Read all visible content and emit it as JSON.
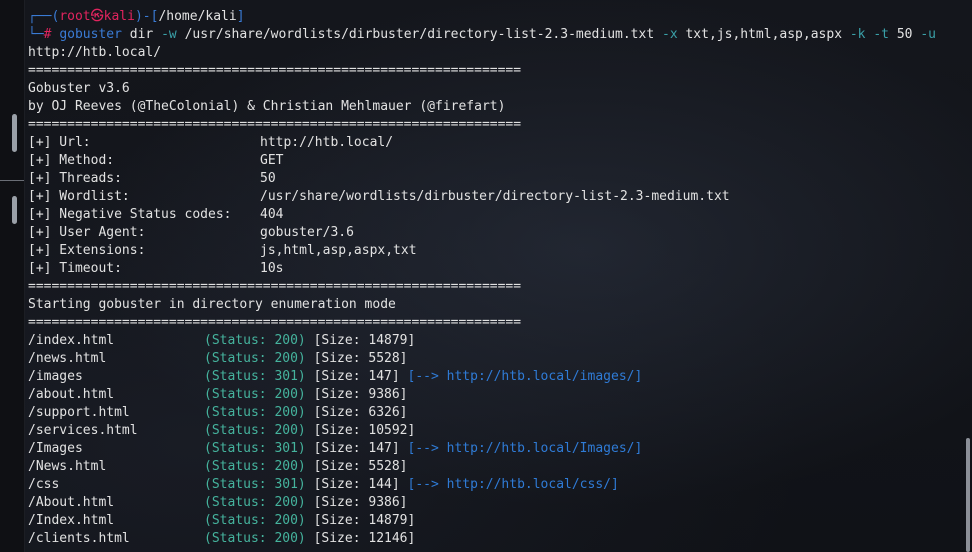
{
  "prompt": {
    "user": "root",
    "symbol": "㉿",
    "host": "kali",
    "path": "/home/kali",
    "hash": "#",
    "command": "gobuster",
    "args_before": "dir",
    "flag_w": "-w",
    "wordlist_arg": "/usr/share/wordlists/dirbuster/directory-list-2.3-medium.txt",
    "flag_x": "-x",
    "ext_arg": "txt,js,html,asp,aspx",
    "flag_k": "-k",
    "flag_t": "-t",
    "threads_arg": "50",
    "flag_u": "-u",
    "url_arg": "http://htb.local/"
  },
  "separator": "===============================================================",
  "banner": {
    "version": "Gobuster v3.6",
    "authors": "by OJ Reeves (@TheColonial) & Christian Mehlmauer (@firefart)"
  },
  "config": [
    {
      "key": "[+] Url:",
      "value": "http://htb.local/"
    },
    {
      "key": "[+] Method:",
      "value": "GET"
    },
    {
      "key": "[+] Threads:",
      "value": "50"
    },
    {
      "key": "[+] Wordlist:",
      "value": "/usr/share/wordlists/dirbuster/directory-list-2.3-medium.txt"
    },
    {
      "key": "[+] Negative Status codes:",
      "value": "404"
    },
    {
      "key": "[+] User Agent:",
      "value": "gobuster/3.6"
    },
    {
      "key": "[+] Extensions:",
      "value": "js,html,asp,aspx,txt"
    },
    {
      "key": "[+] Timeout:",
      "value": "10s"
    }
  ],
  "start_message": "Starting gobuster in directory enumeration mode",
  "results": [
    {
      "path": "/index.html",
      "status": "(Status: 200)",
      "size": "[Size: 14879]",
      "redirect": ""
    },
    {
      "path": "/news.html",
      "status": "(Status: 200)",
      "size": "[Size: 5528]",
      "redirect": ""
    },
    {
      "path": "/images",
      "status": "(Status: 301)",
      "size": "[Size: 147]",
      "redirect": "[--> http://htb.local/images/]"
    },
    {
      "path": "/about.html",
      "status": "(Status: 200)",
      "size": "[Size: 9386]",
      "redirect": ""
    },
    {
      "path": "/support.html",
      "status": "(Status: 200)",
      "size": "[Size: 6326]",
      "redirect": ""
    },
    {
      "path": "/services.html",
      "status": "(Status: 200)",
      "size": "[Size: 10592]",
      "redirect": ""
    },
    {
      "path": "/Images",
      "status": "(Status: 301)",
      "size": "[Size: 147]",
      "redirect": "[--> http://htb.local/Images/]"
    },
    {
      "path": "/News.html",
      "status": "(Status: 200)",
      "size": "[Size: 5528]",
      "redirect": ""
    },
    {
      "path": "/css",
      "status": "(Status: 301)",
      "size": "[Size: 144]",
      "redirect": "[--> http://htb.local/css/]"
    },
    {
      "path": "/About.html",
      "status": "(Status: 200)",
      "size": "[Size: 9386]",
      "redirect": ""
    },
    {
      "path": "/Index.html",
      "status": "(Status: 200)",
      "size": "[Size: 14879]",
      "redirect": ""
    },
    {
      "path": "/clients.html",
      "status": "(Status: 200)",
      "size": "[Size: 12146]",
      "redirect": ""
    }
  ],
  "colors": {
    "background": "#121419",
    "text": "#e2e2e2",
    "prompt_blue": "#3a7bd5",
    "prompt_red": "#e0245e",
    "status_green": "#45b39d",
    "link_blue": "#2f7bd6"
  }
}
